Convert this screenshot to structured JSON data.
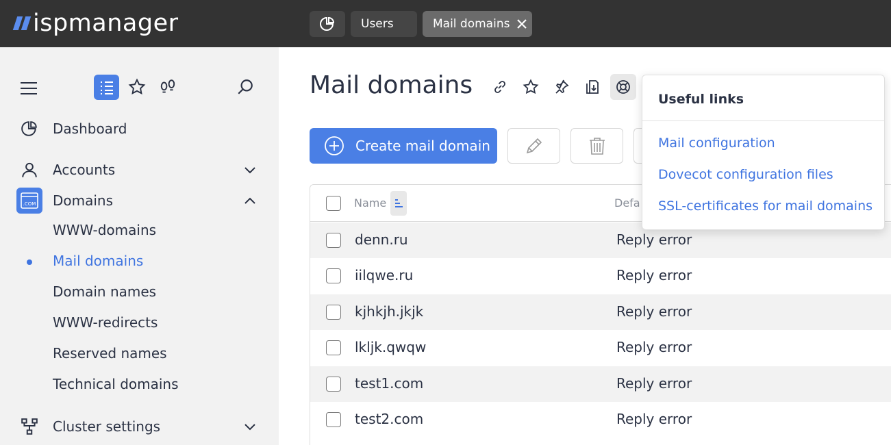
{
  "app": {
    "logo_text": "ispmanager",
    "colors": {
      "topbar": "#333333",
      "accent": "#4a7fe5",
      "link": "#3f74e0",
      "sidebar_bg": "#f2f2f2"
    }
  },
  "tabs": [
    {
      "label": "",
      "icon": "dashboard-icon"
    },
    {
      "label": "Users"
    },
    {
      "label": "Mail domains",
      "active": true,
      "close_icon": "close-icon"
    }
  ],
  "sidebar": {
    "tools": [
      "menu-icon",
      "list-view-icon",
      "star-icon",
      "footprints-icon",
      "search-icon"
    ],
    "items": [
      {
        "label": "Dashboard",
        "icon": "dashboard-icon"
      },
      {
        "label": "Accounts",
        "icon": "user-icon",
        "expanded": false
      },
      {
        "label": "Domains",
        "icon": "domain-com-icon",
        "expanded": true
      },
      {
        "label": "Cluster settings",
        "icon": "cluster-icon",
        "expanded": false
      }
    ],
    "subitems": [
      {
        "label": "WWW-domains"
      },
      {
        "label": "Mail domains",
        "active": true
      },
      {
        "label": "Domain names"
      },
      {
        "label": "WWW-redirects"
      },
      {
        "label": "Reserved names"
      },
      {
        "label": "Technical domains"
      }
    ]
  },
  "main": {
    "title": "Mail domains",
    "title_icons": [
      "link-icon",
      "star-icon",
      "pin-icon",
      "export-icon",
      "lifebuoy-icon"
    ],
    "toolbar": {
      "create_label": "Create mail domain",
      "edit_icon": "pencil-icon",
      "delete_icon": "trash-icon"
    },
    "table": {
      "columns": [
        "Name",
        "Defa"
      ],
      "rows": [
        {
          "name": "denn.ru",
          "default": "Reply error"
        },
        {
          "name": "iilqwe.ru",
          "default": "Reply error"
        },
        {
          "name": "kjhkjh.jkjk",
          "default": "Reply error"
        },
        {
          "name": "lkljk.qwqw",
          "default": "Reply error"
        },
        {
          "name": "test1.com",
          "default": "Reply error"
        },
        {
          "name": "test2.com",
          "default": "Reply error"
        }
      ]
    }
  },
  "popup": {
    "title": "Useful links",
    "links": [
      "Mail configuration",
      "Dovecot configuration files",
      "SSL-certificates for mail domains"
    ]
  }
}
